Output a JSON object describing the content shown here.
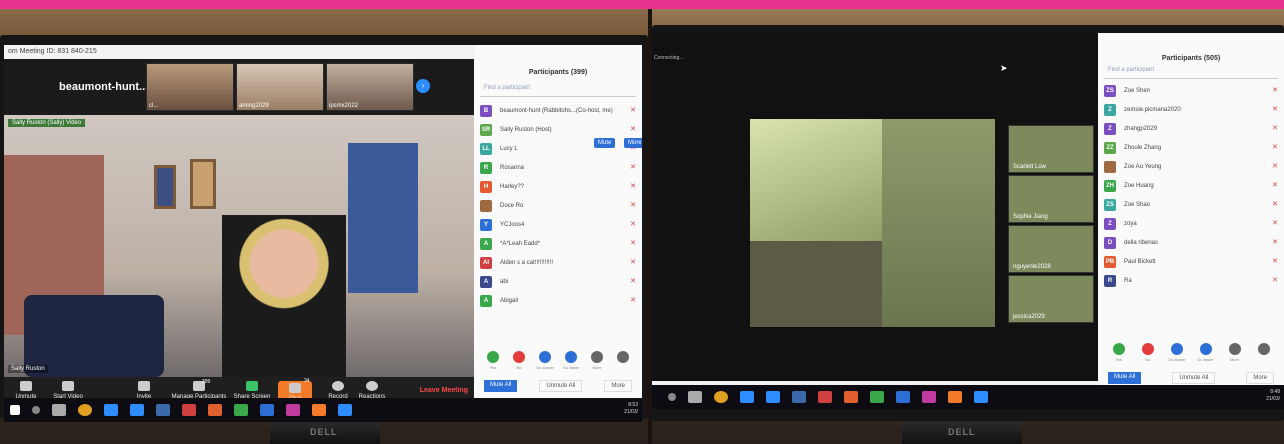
{
  "left": {
    "meeting_title": "om Meeting ID: 831 840-215",
    "host_name": "beaumont-hunt...",
    "thumbnails": [
      {
        "label": "cl..."
      },
      {
        "label": "aming2029"
      },
      {
        "label": "ipsmx2022"
      }
    ],
    "speaker_tag": "Sally Ruston (Sally) Video",
    "video_name": "Sally Ruston",
    "toolbar": {
      "unmute": "Unmute",
      "start_video": "Start Video",
      "invite": "Invite",
      "participants_count": "399",
      "manage_participants": "Manage Participants",
      "share_screen": "Share Screen",
      "chat": "Chat",
      "chat_badge": "34",
      "record": "Record",
      "reactions": "Reactions",
      "leave": "Leave Meeting"
    },
    "panel": {
      "title": "Participants (399)",
      "search_placeholder": "Find a participant",
      "items": [
        {
          "initial": "B",
          "name": "beaumont-hunt (Rabbitohs...(Co-host, me)",
          "color": "#7b4fc0"
        },
        {
          "initial": "SR",
          "name": "Sally Ruston (Host)",
          "color": "#5aa84a"
        },
        {
          "initial": "LL",
          "name": "Lucy L",
          "color": "#3aa8a0"
        },
        {
          "initial": "R",
          "name": "Rosanna",
          "color": "#3aa84a"
        },
        {
          "initial": "H",
          "name": "Harley??",
          "color": "#e45a30"
        },
        {
          "initial": "",
          "name": "Doce Ro",
          "color": "#a06a40"
        },
        {
          "initial": "Y",
          "name": "YCJoos4",
          "color": "#2d6fd6"
        },
        {
          "initial": "A",
          "name": "*A*Leah Eadd*",
          "color": "#3aa84a"
        },
        {
          "initial": "AI",
          "name": "Alden s a cat!!!!!!!!!!!",
          "color": "#d04040"
        },
        {
          "initial": "A",
          "name": "abi",
          "color": "#3a4a8c"
        },
        {
          "initial": "A",
          "name": "Abigail",
          "color": "#3aa84a"
        }
      ],
      "mute_btn": "Mute",
      "more_btn": "More",
      "reactions": [
        "Yes",
        "No",
        "Go slower",
        "Go faster",
        "More",
        ""
      ],
      "mute_all": "Mute All",
      "unmute_all": "Unmute All",
      "more": "More"
    },
    "clock": {
      "time": "8:53",
      "date": "21/03/"
    }
  },
  "right": {
    "connecting": "Connecting...",
    "thumbnails": [
      {
        "label": "Scarlett Low"
      },
      {
        "label": "Sophie Jiang"
      },
      {
        "label": "nguyenle2028"
      },
      {
        "label": "jessica2029"
      }
    ],
    "panel": {
      "title": "Participants (505)",
      "search_placeholder": "Find a participant",
      "items": [
        {
          "initial": "ZS",
          "name": "Zoe Shen",
          "color": "#7b4fc0"
        },
        {
          "initial": "Z",
          "name": "zemsie.picmana2020",
          "color": "#3aa8a0"
        },
        {
          "initial": "Z",
          "name": "zhangp2029",
          "color": "#7b4fc0"
        },
        {
          "initial": "ZZ",
          "name": "Zhoule Zhang",
          "color": "#5aa84a"
        },
        {
          "initial": "",
          "name": "Zoe Au Yeung",
          "color": "#a06a40"
        },
        {
          "initial": "ZH",
          "name": "Zoe Huang",
          "color": "#3aa84a"
        },
        {
          "initial": "ZS",
          "name": "Zoe Shao",
          "color": "#3aa8a0"
        },
        {
          "initial": "Z",
          "name": "zoya",
          "color": "#7b4fc0"
        },
        {
          "initial": "D",
          "name": "della ribenas",
          "color": "#7b4fc0"
        },
        {
          "initial": "PB",
          "name": "Paul Bickett",
          "color": "#e45a30"
        },
        {
          "initial": "R",
          "name": "Ra",
          "color": "#3a4a8c"
        }
      ],
      "reactions": [
        "Yes",
        "No",
        "Go slower",
        "Go faster",
        "More",
        ""
      ],
      "mute_all": "Mute All",
      "unmute_all": "Unmute All",
      "more": "More"
    },
    "clock": {
      "time": "8:48",
      "date": "21/03/"
    }
  },
  "monitor_brand": "DELL"
}
